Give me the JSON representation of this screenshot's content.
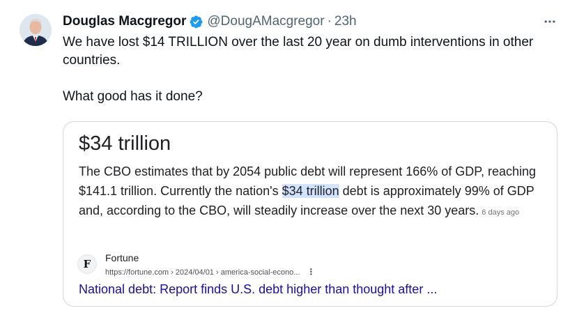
{
  "tweet": {
    "author_name": "Douglas Macgregor",
    "handle": "@DougAMacgregor",
    "separator": "·",
    "time": "23h",
    "text_line1": "We have lost $14 TRILLION over the last 20 year on dumb interventions in other countries.",
    "text_line2": "What good has it done?",
    "verified_icon": "verified-badge-icon",
    "more_icon": "more-horizontal-icon",
    "colors": {
      "verified": "#1d9bf0",
      "secondary_text": "#536471",
      "card_border": "#cfd9de"
    }
  },
  "card": {
    "title": "$34 trillion",
    "snippet_before": "The CBO estimates that by 2054 public debt will represent 166% of GDP, reaching $141.1 trillion. Currently the nation's ",
    "snippet_highlight": "$34 trillion",
    "snippet_after": " debt is approximately 99% of GDP and, according to the CBO, will steadily increase over the next 30 years.",
    "age": "6 days ago",
    "source_name": "Fortune",
    "source_favicon_letter": "F",
    "source_url": "https://fortune.com › 2024/04/01 › america-social-econo...",
    "menu_glyph": "⋮",
    "link_text": "National debt: Report finds U.S. debt higher than thought after ...",
    "colors": {
      "highlight": "#d3e3fd",
      "link": "#1a0dab"
    }
  }
}
